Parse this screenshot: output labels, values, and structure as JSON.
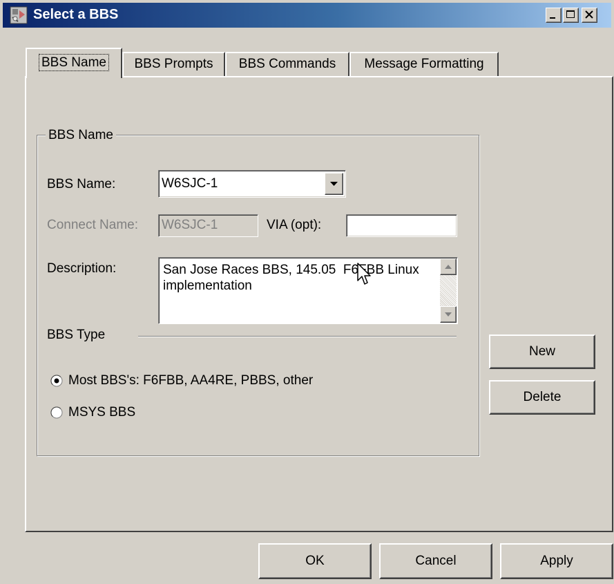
{
  "window": {
    "title": "Select a BBS"
  },
  "tabs": [
    {
      "label": "BBS Name",
      "active": true
    },
    {
      "label": "BBS Prompts",
      "active": false
    },
    {
      "label": "BBS Commands",
      "active": false
    },
    {
      "label": "Message Formatting",
      "active": false
    }
  ],
  "group": {
    "legend": "BBS Name",
    "bbs_name_label": "BBS Name:",
    "bbs_name_value": "W6SJC-1",
    "connect_name_label": "Connect Name:",
    "connect_name_value": "W6SJC-1",
    "via_label": "VIA (opt):",
    "via_value": "",
    "description_label": "Description:",
    "description_value": "San Jose Races BBS, 145.05  F6FBB Linux implementation",
    "bbs_type_label": "BBS Type",
    "radio_options": [
      {
        "label": "Most BBS's: F6FBB, AA4RE, PBBS, other",
        "checked": true
      },
      {
        "label": "MSYS BBS",
        "checked": false
      }
    ]
  },
  "side_buttons": {
    "new_label": "New",
    "delete_label": "Delete"
  },
  "footer_buttons": {
    "ok_label": "OK",
    "cancel_label": "Cancel",
    "apply_label": "Apply"
  }
}
